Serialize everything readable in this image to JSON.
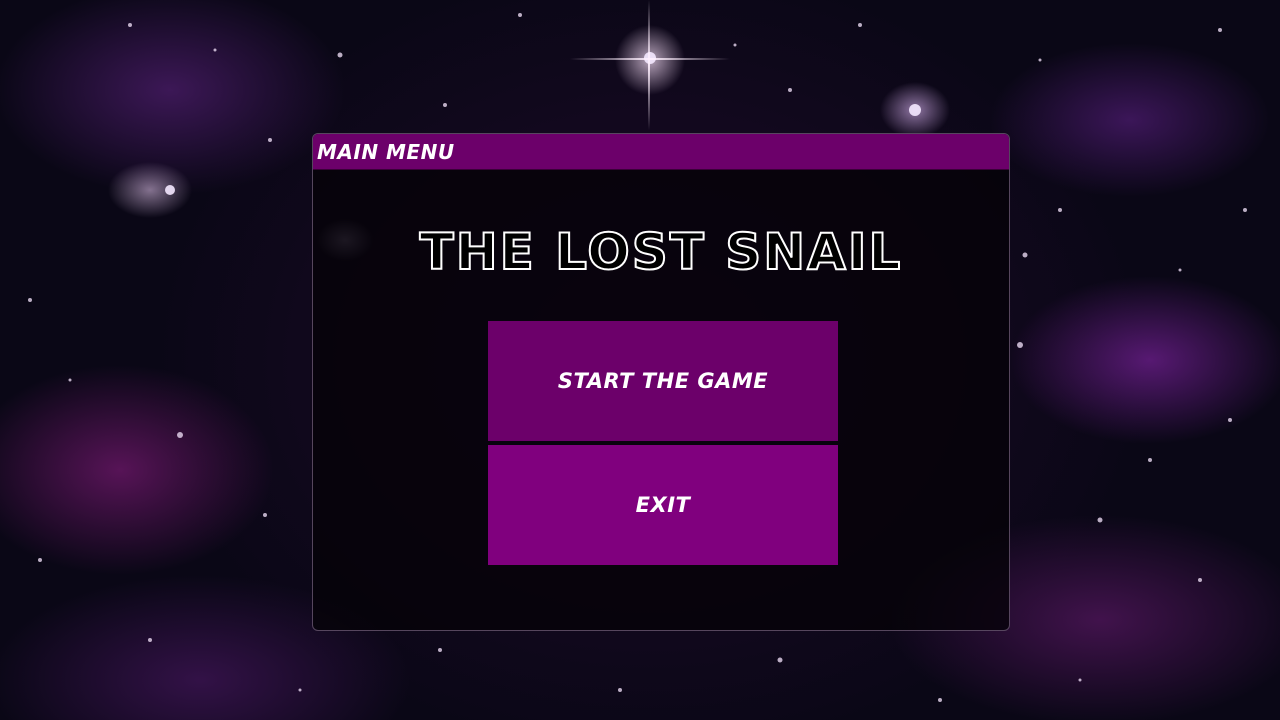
{
  "window": {
    "header_title": "MAIN MENU"
  },
  "game": {
    "title": "THE LOST SNAIL"
  },
  "menu": {
    "start_label": "START THE GAME",
    "exit_label": "EXIT"
  },
  "colors": {
    "accent": "#6c006a",
    "exit_button": "#80007e",
    "panel_bg": "#050208",
    "text": "#ffffff"
  }
}
